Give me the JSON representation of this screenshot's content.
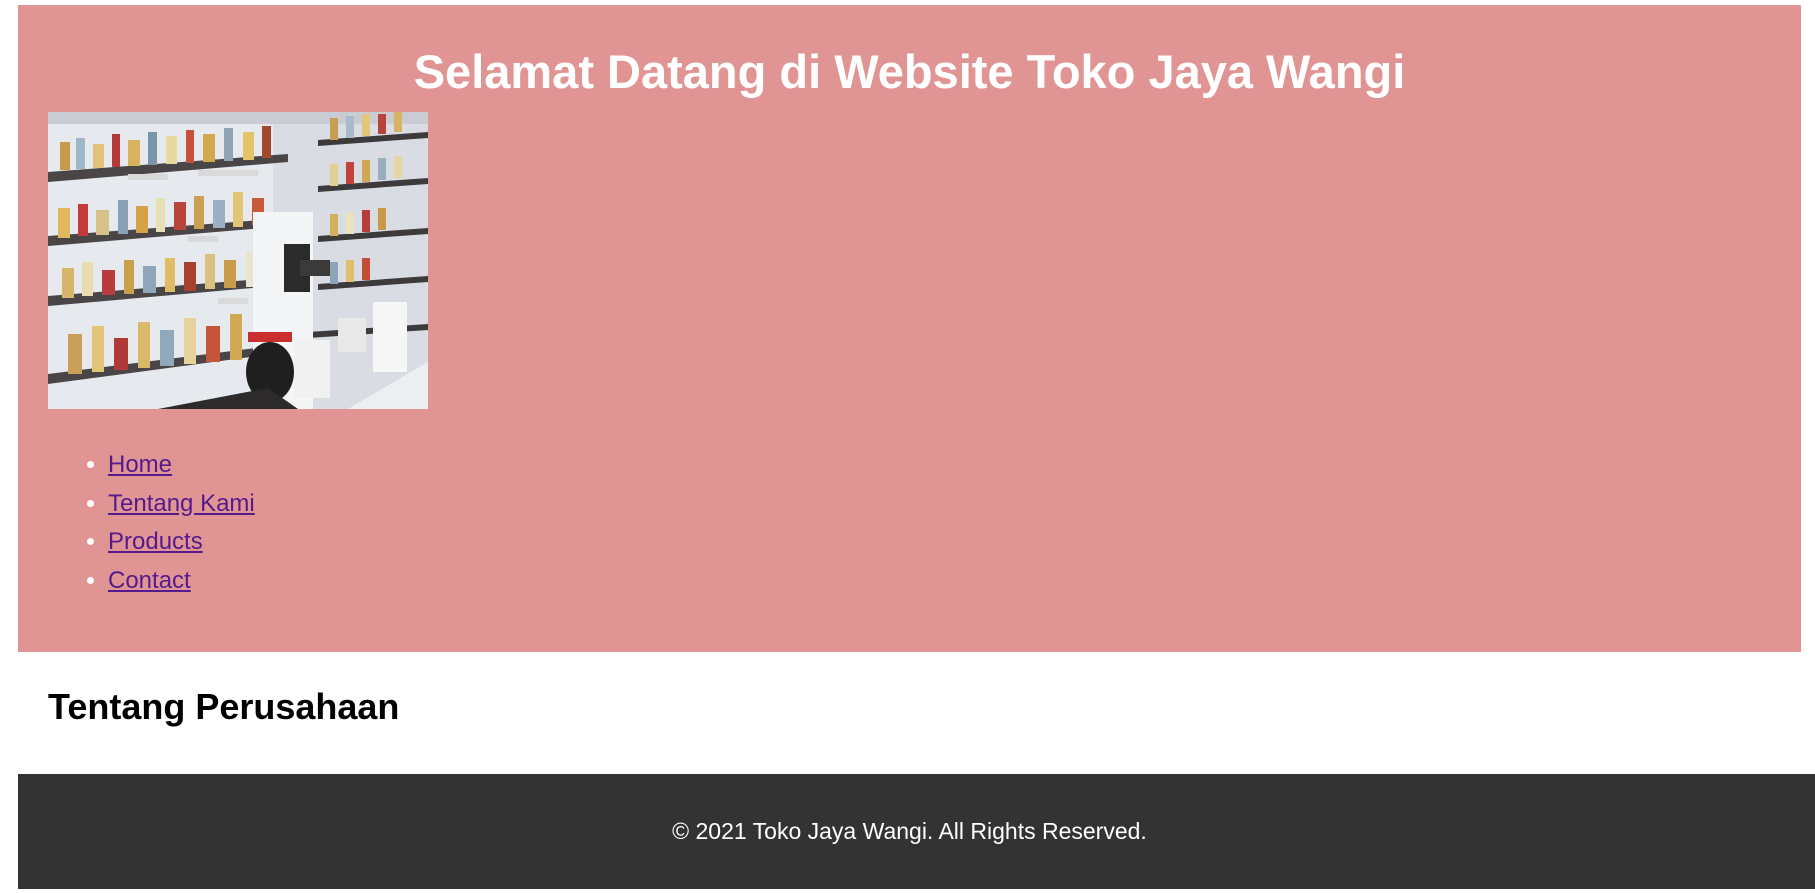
{
  "colors": {
    "header_bg": "#e09594",
    "footer_bg": "#333333",
    "link": "#551a8b",
    "title": "#ffffff"
  },
  "header": {
    "title": "Selamat Datang di Website Toko Jaya Wangi",
    "hero_image": {
      "alt": "perfume-shelves-photo"
    }
  },
  "nav": {
    "items": [
      {
        "label": "Home"
      },
      {
        "label": "Tentang Kami"
      },
      {
        "label": "Products"
      },
      {
        "label": "Contact"
      }
    ]
  },
  "main": {
    "section_title": "Tentang Perusahaan"
  },
  "footer": {
    "text": "© 2021 Toko Jaya Wangi. All Rights Reserved."
  }
}
